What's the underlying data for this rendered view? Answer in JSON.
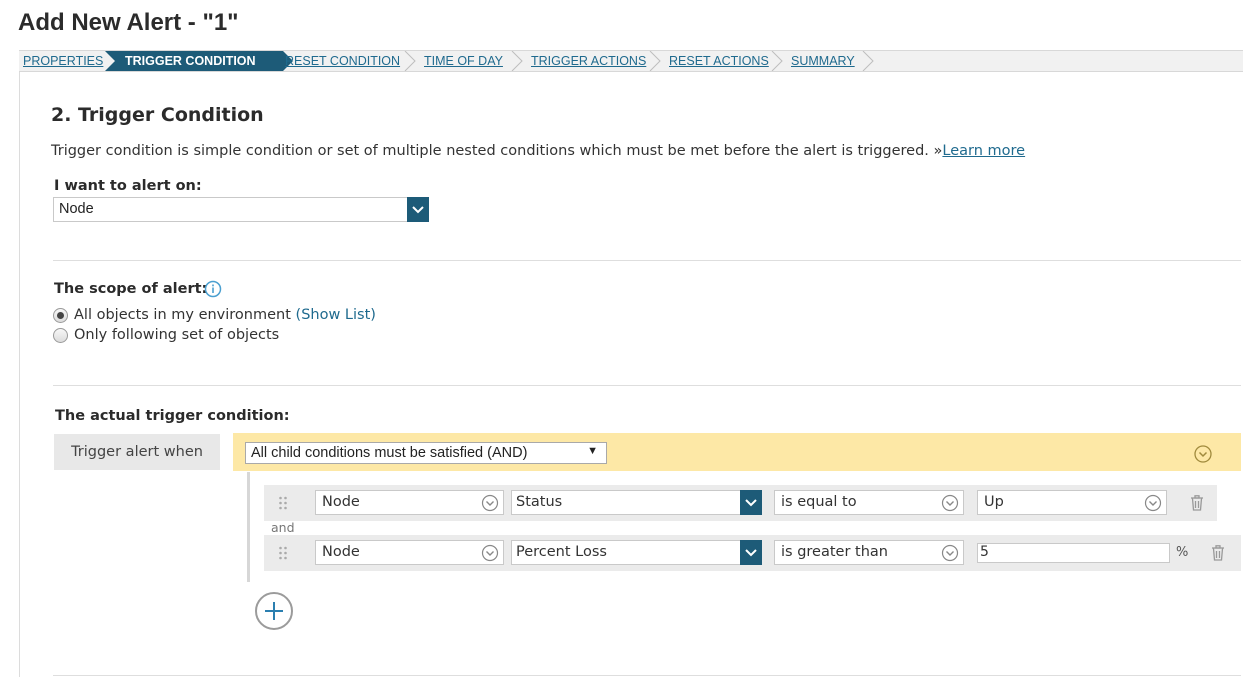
{
  "page_title": "Add New Alert - \"1\"",
  "steps": [
    {
      "label": "PROPERTIES",
      "active": false
    },
    {
      "label": "TRIGGER CONDITION",
      "active": true
    },
    {
      "label": "RESET CONDITION",
      "active": false
    },
    {
      "label": "TIME OF DAY",
      "active": false
    },
    {
      "label": "TRIGGER ACTIONS",
      "active": false
    },
    {
      "label": "RESET ACTIONS",
      "active": false
    },
    {
      "label": "SUMMARY",
      "active": false
    }
  ],
  "section": {
    "title": "2. Trigger Condition",
    "description": "Trigger condition is simple condition or set of multiple nested conditions which must be met before the alert is triggered. »",
    "learn_more": "Learn more"
  },
  "alert_on": {
    "label": "I want to alert on:",
    "value": "Node"
  },
  "scope": {
    "label": "The scope of alert:",
    "info_icon": "info-icon",
    "options": [
      {
        "label": "All objects in my environment",
        "link": "(Show List)",
        "selected": true
      },
      {
        "label": "Only following set of objects",
        "selected": false
      }
    ]
  },
  "trigger": {
    "label": "The actual trigger condition:",
    "when_label": "Trigger alert when",
    "logic_value": "All child conditions must be satisfied (AND)",
    "conjunction": "and",
    "conditions": [
      {
        "object": "Node",
        "field": "Status",
        "operator": "is equal to",
        "value": "Up",
        "unit": ""
      },
      {
        "object": "Node",
        "field": "Percent Loss",
        "operator": "is greater than",
        "value": "5",
        "unit": "%"
      }
    ]
  },
  "colors": {
    "accent": "#1d5b78",
    "link": "#1f6a8e",
    "highlight": "#fde8a6"
  }
}
